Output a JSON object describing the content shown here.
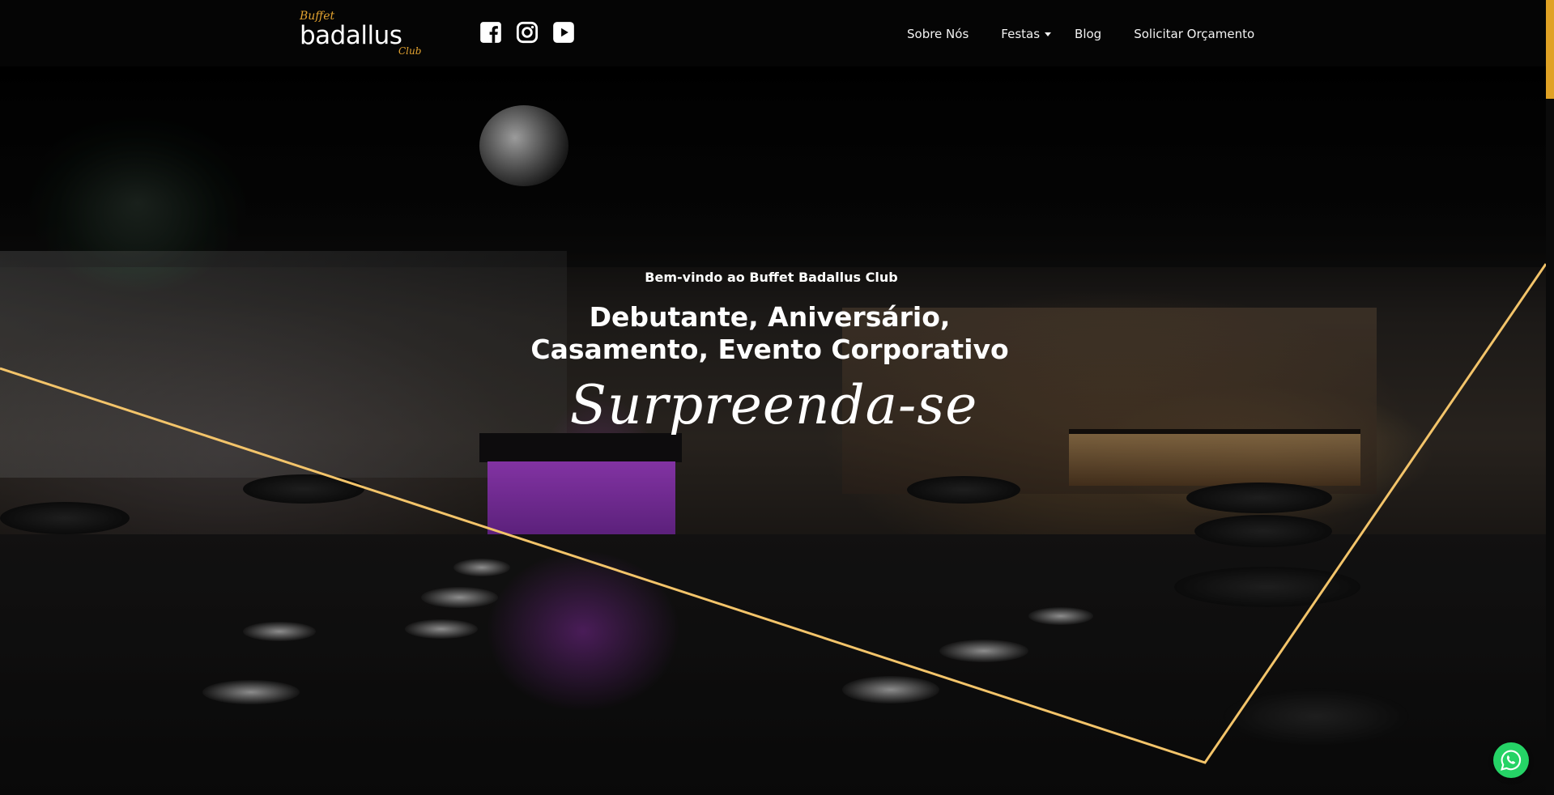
{
  "brand": {
    "logo_top": "Buffet",
    "logo_name": "badallus",
    "logo_bottom": "Club",
    "accent": "#E0A225"
  },
  "social": [
    {
      "icon": "facebook-icon"
    },
    {
      "icon": "instagram-icon"
    },
    {
      "icon": "youtube-icon"
    }
  ],
  "nav": {
    "items": [
      {
        "label": "Sobre Nós"
      },
      {
        "label": "Festas"
      },
      {
        "label": "Blog"
      },
      {
        "label": "Solicitar Orçamento"
      }
    ]
  },
  "hero": {
    "welcome": "Bem-vindo ao Buffet Badallus Club",
    "headline_line1": "Debutante, Aniversário,",
    "headline_line2": "Casamento, Evento Corporativo",
    "script": "Surpreenda-se"
  },
  "floating": {
    "whatsapp_icon": "whatsapp-icon",
    "whatsapp_color": "#25D366"
  }
}
